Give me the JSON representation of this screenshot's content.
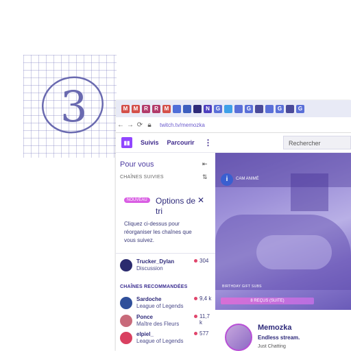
{
  "notebook": {
    "number": "3"
  },
  "bookmarks": [
    {
      "icon": "gmail-icon",
      "letter": "M",
      "color": "#d4504a"
    },
    {
      "icon": "gmail-icon",
      "letter": "M",
      "color": "#d4504a"
    },
    {
      "icon": "r-icon",
      "letter": "R",
      "color": "#b23a6a"
    },
    {
      "icon": "r-icon",
      "letter": "R",
      "color": "#b23a6a"
    },
    {
      "icon": "gmail-icon",
      "letter": "M",
      "color": "#d4504a"
    },
    {
      "icon": "calendar-icon",
      "letter": "",
      "color": "#4f6ed8"
    },
    {
      "icon": "trello-icon",
      "letter": "",
      "color": "#3d5fbf"
    },
    {
      "icon": "bookmark-icon",
      "letter": "",
      "color": "#2e2a7a"
    },
    {
      "icon": "n-icon",
      "letter": "N",
      "color": "#4d3fbf"
    },
    {
      "icon": "google-icon",
      "letter": "G",
      "color": "#5a6fd8"
    },
    {
      "icon": "twitter-icon",
      "letter": "",
      "color": "#3ea0e8"
    },
    {
      "icon": "translate-icon",
      "letter": "",
      "color": "#5a6fd8"
    },
    {
      "icon": "google-icon",
      "letter": "G",
      "color": "#5a6fd8"
    },
    {
      "icon": "globe-icon",
      "letter": "",
      "color": "#4a4a9a"
    },
    {
      "icon": "translate-icon",
      "letter": "",
      "color": "#5a6fd8"
    },
    {
      "icon": "google-icon",
      "letter": "G",
      "color": "#5a6fd8"
    },
    {
      "icon": "bars-icon",
      "letter": "",
      "color": "#4a4a9a"
    },
    {
      "icon": "google-icon",
      "letter": "G",
      "color": "#5a6fd8"
    }
  ],
  "browser": {
    "url": "twitch.tv/memozka"
  },
  "twitch": {
    "nav": {
      "following": "Suivis",
      "browse": "Parcourir",
      "more": "⋮",
      "search_placeholder": "Rechercher"
    },
    "sidebar": {
      "title": "Pour vous",
      "followed_header": "CHAÎNES SUIVIES",
      "recommended_header": "CHAÎNES RECOMMANDÉES",
      "popup": {
        "badge": "NOUVEAU",
        "title": "Options de tri",
        "body": "Cliquez ci-dessus pour réorganiser les chaînes que vous suivez."
      },
      "followed": [
        {
          "name": "Trucker_Dylan",
          "category": "Discussion",
          "viewers": "304",
          "avatar_color": "#2b2b6e"
        }
      ],
      "recommended": [
        {
          "name": "Sardoche",
          "category": "League of Legends",
          "viewers": "9,4 k",
          "avatar_color": "#2f4f9a"
        },
        {
          "name": "Ponce",
          "category": "Maître des Fleurs",
          "viewers": "11,7 k",
          "avatar_color": "#c86a7a"
        },
        {
          "name": "elpiel_",
          "category": "League of Legends",
          "viewers": "577",
          "avatar_color": "#d94060"
        }
      ]
    },
    "player": {
      "tag": "CAM ANIMÉ",
      "birthday": "BIRTHDAY GIFT SUBS",
      "progress_label": "8 REÇUS (SUITE)"
    },
    "channel": {
      "name": "Memozka",
      "title": "Endless stream.",
      "extra": "Just Chatting"
    }
  }
}
